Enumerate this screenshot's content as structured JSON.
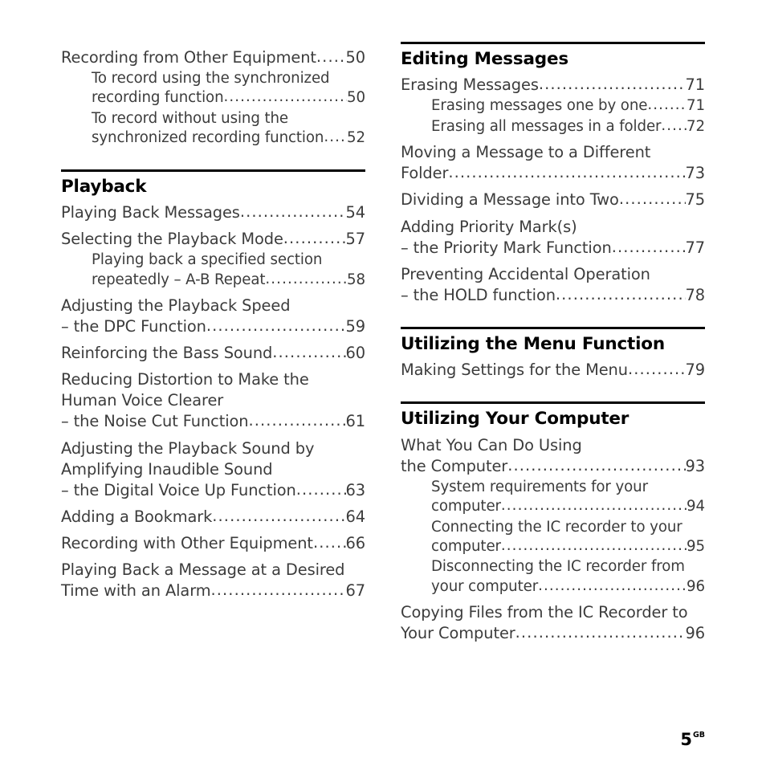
{
  "document": {
    "type": "table-of-contents",
    "folio": {
      "number": "5",
      "region": "GB"
    },
    "leader_char": "."
  },
  "left_column": {
    "sections": [
      {
        "heading": null,
        "has_rule": false,
        "entries": [
          {
            "level": "main",
            "lines": [
              "Recording from Other Equipment"
            ],
            "page": "50"
          },
          {
            "level": "sub",
            "lines": [
              "To record using the synchronized",
              "recording function"
            ],
            "page": "50"
          },
          {
            "level": "sub",
            "lines": [
              "To record without using the",
              "synchronized recording function"
            ],
            "page": "52"
          }
        ]
      },
      {
        "heading": "Playback",
        "has_rule": true,
        "entries": [
          {
            "level": "main",
            "lines": [
              "Playing Back Messages"
            ],
            "page": "54"
          },
          {
            "level": "main",
            "lines": [
              "Selecting the Playback Mode"
            ],
            "page": "57"
          },
          {
            "level": "sub",
            "lines": [
              "Playing back a specified section",
              "repeatedly – A-B Repeat"
            ],
            "page": "58"
          },
          {
            "level": "main",
            "lines": [
              "Adjusting the Playback Speed",
              "– the DPC Function"
            ],
            "page": "59"
          },
          {
            "level": "main",
            "lines": [
              "Reinforcing the Bass Sound"
            ],
            "page": "60"
          },
          {
            "level": "main",
            "lines": [
              "Reducing Distortion to Make the",
              "Human Voice Clearer",
              "– the Noise Cut Function"
            ],
            "page": "61"
          },
          {
            "level": "main",
            "lines": [
              "Adjusting the Playback Sound by",
              "Amplifying Inaudible Sound",
              "– the Digital Voice Up Function"
            ],
            "page": "63"
          },
          {
            "level": "main",
            "lines": [
              "Adding a Bookmark"
            ],
            "page": "64"
          },
          {
            "level": "main",
            "lines": [
              "Recording with Other Equipment"
            ],
            "page": "66"
          },
          {
            "level": "main",
            "lines": [
              "Playing Back a Message at a Desired",
              "Time with an Alarm"
            ],
            "page": "67"
          }
        ]
      }
    ]
  },
  "right_column": {
    "sections": [
      {
        "heading": "Editing Messages",
        "has_rule": true,
        "entries": [
          {
            "level": "main",
            "lines": [
              "Erasing Messages"
            ],
            "page": "71"
          },
          {
            "level": "sub",
            "lines": [
              "Erasing messages one by one"
            ],
            "page": "71"
          },
          {
            "level": "sub",
            "lines": [
              "Erasing all messages in a folder"
            ],
            "page": "72"
          },
          {
            "level": "main",
            "lines": [
              "Moving a Message to a Different",
              "Folder"
            ],
            "page": "73"
          },
          {
            "level": "main",
            "lines": [
              "Dividing a Message into Two"
            ],
            "page": "75"
          },
          {
            "level": "main",
            "lines": [
              "Adding Priority Mark(s)",
              "– the Priority Mark Function"
            ],
            "page": "77"
          },
          {
            "level": "main",
            "lines": [
              "Preventing Accidental Operation",
              "– the HOLD function"
            ],
            "page": "78"
          }
        ]
      },
      {
        "heading": "Utilizing the Menu Function",
        "has_rule": true,
        "entries": [
          {
            "level": "main",
            "lines": [
              "Making Settings for the Menu"
            ],
            "page": "79"
          }
        ]
      },
      {
        "heading": "Utilizing Your Computer",
        "has_rule": true,
        "entries": [
          {
            "level": "main",
            "lines": [
              "What You Can Do Using",
              "the Computer"
            ],
            "page": "93"
          },
          {
            "level": "sub",
            "lines": [
              "System requirements for your",
              "computer"
            ],
            "page": "94"
          },
          {
            "level": "sub",
            "lines": [
              "Connecting the IC recorder to your",
              "computer"
            ],
            "page": "95"
          },
          {
            "level": "sub",
            "lines": [
              "Disconnecting the IC recorder from",
              "your computer"
            ],
            "page": "96"
          },
          {
            "level": "main",
            "lines": [
              "Copying Files from the IC Recorder to",
              "Your Computer"
            ],
            "page": "96"
          }
        ]
      }
    ]
  }
}
